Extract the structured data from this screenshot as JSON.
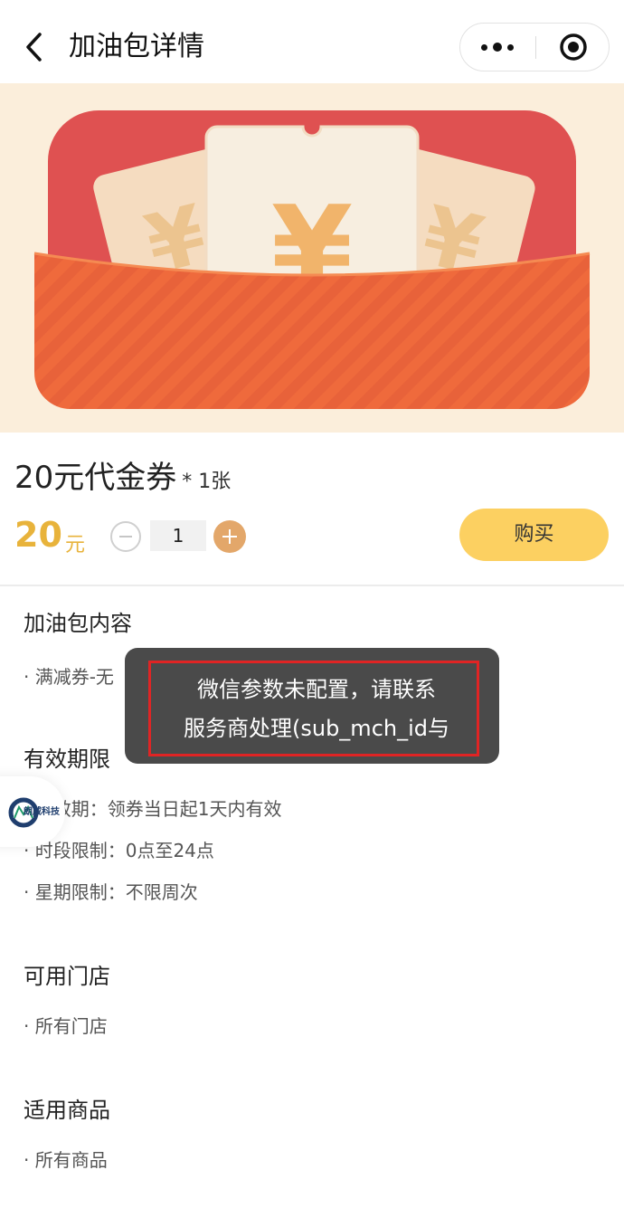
{
  "nav": {
    "title": "加油包详情",
    "back_icon": "chevron-left-icon",
    "more_icon": "more-dots-icon",
    "close_icon": "target-close-icon"
  },
  "banner": {
    "image": "red-envelope-coupon-illustration",
    "symbol": "¥",
    "colors": {
      "background": "#fbeedb",
      "card": "#df5151",
      "envelope": "#ef6a3c",
      "ticket": "#f7eee0",
      "yen": "#f1b46b"
    }
  },
  "product": {
    "name": "20元代金券",
    "quantity_label": "* 1张",
    "price": "20",
    "price_unit": "元",
    "quantity": "1",
    "buy_label": "购买",
    "accent_color": "#fcd061"
  },
  "sections": [
    {
      "title": "加油包内容",
      "items": [
        "· 满减券-无"
      ]
    },
    {
      "title": "有效期限",
      "items": [
        "· 有效期：领券当日起1天内有效",
        "· 时段限制：0点至24点",
        "· 星期限制：不限周次"
      ]
    },
    {
      "title": "可用门店",
      "items": [
        "· 所有门店"
      ]
    },
    {
      "title": "适用商品",
      "items": [
        "· 所有商品"
      ]
    }
  ],
  "toast": {
    "line1": "微信参数未配置，请联系",
    "line2": "服务商处理(sub_mch_id与"
  },
  "side_button": {
    "logo_text": "朗威科技"
  }
}
